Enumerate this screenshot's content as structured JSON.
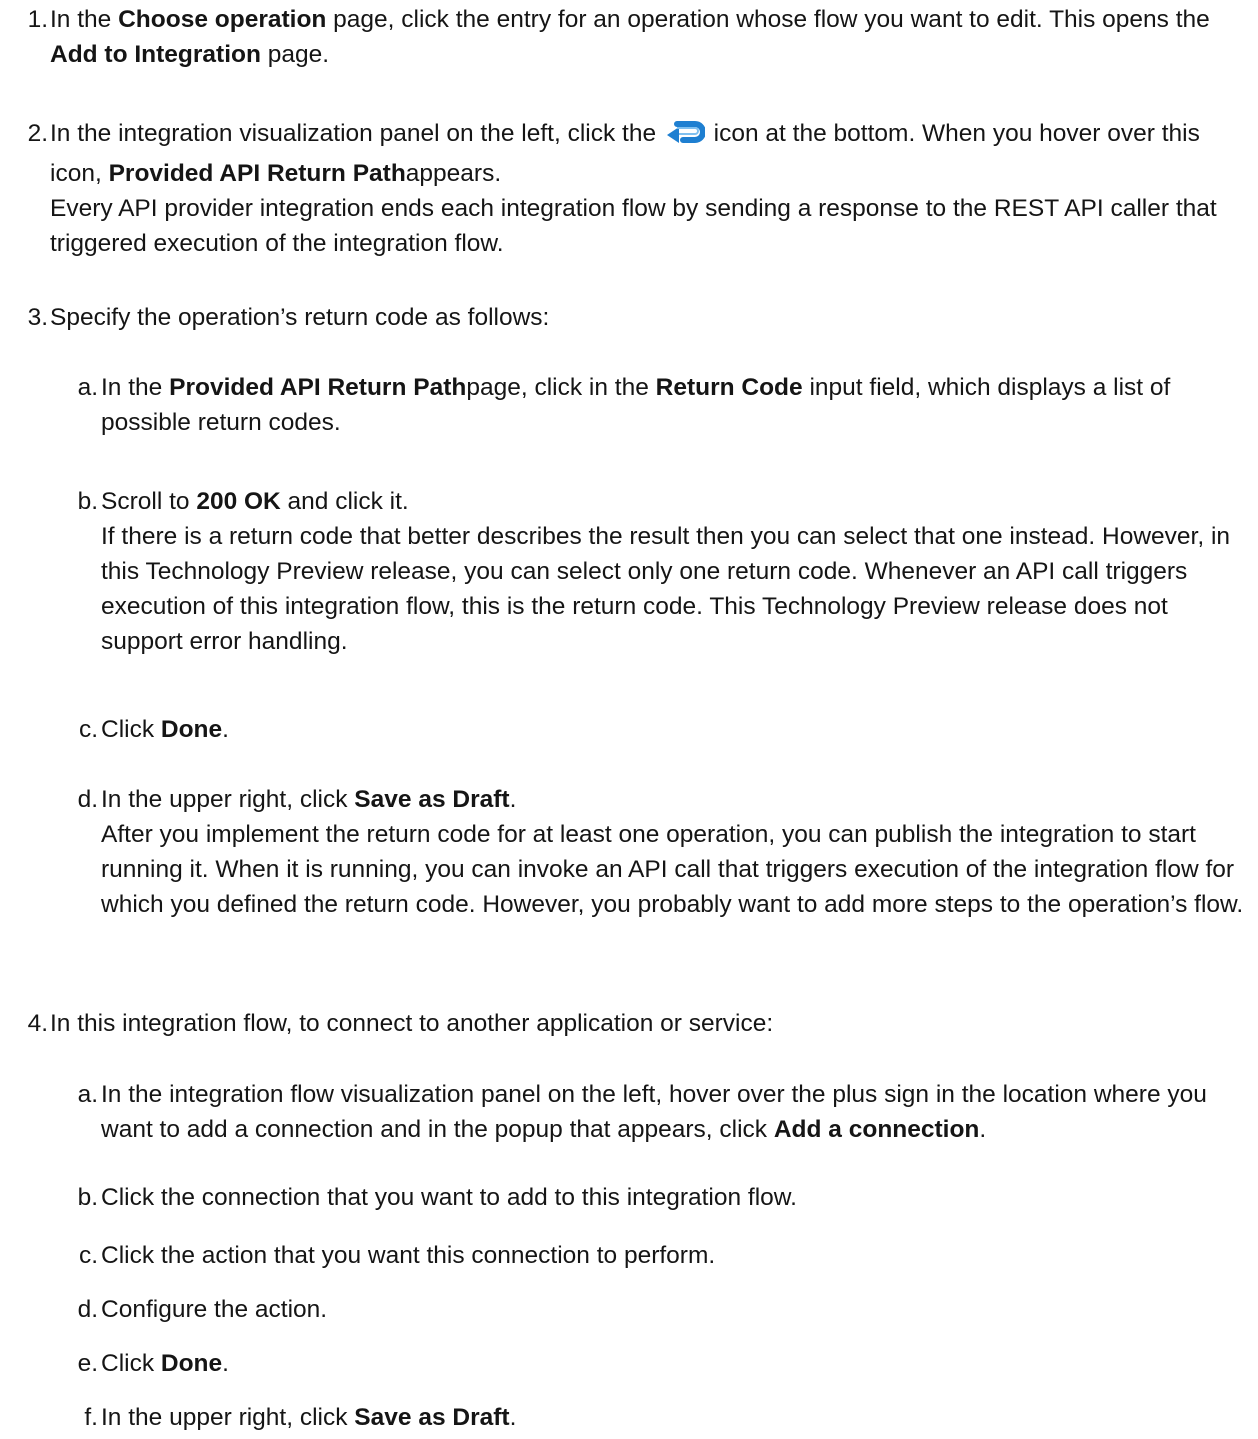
{
  "steps": [
    {
      "num": "1.",
      "parts": [
        "In the ",
        "Choose operation",
        " page, click the entry for an operation whose flow you want to edit. This opens the ",
        "Add to Integration",
        " page."
      ]
    },
    {
      "num": "2.",
      "parts": [
        "In the integration visualization panel on the left, click the ",
        " icon at the bottom. When you hover over this icon, ",
        "Provided API Return Path",
        "appears."
      ],
      "note": "Every API provider integration ends each integration flow by sending a response to the REST API caller that triggered execution of the integration flow.",
      "icon": "return-arrow-icon",
      "icon_color": "#1e7fd1"
    },
    {
      "num": "3.",
      "text": "Specify the operation’s return code as follows:",
      "substeps": [
        {
          "num": "a.",
          "parts": [
            "In the ",
            "Provided API Return Path",
            "page, click in the ",
            "Return Code",
            " input field, which displays a list of possible return codes."
          ]
        },
        {
          "num": "b.",
          "parts": [
            "Scroll to ",
            "200 OK",
            " and click it."
          ],
          "note": "If there is a return code that better describes the result then you can select that one instead. However, in this Technology Preview release, you can select only one return code. Whenever an API call triggers execution of this integration flow, this is the return code. This Technology Preview release does not support error handling."
        },
        {
          "num": "c.",
          "parts": [
            "Click ",
            "Done",
            "."
          ]
        },
        {
          "num": "d.",
          "parts": [
            "In the upper right, click ",
            "Save as Draft",
            "."
          ],
          "note": "After you implement the return code for at least one operation, you can publish the integration to start running it. When it is running, you can invoke an API call that triggers execution of the integration flow for which you defined the return code. However, you probably want to add more steps to the operation’s flow."
        }
      ]
    },
    {
      "num": "4.",
      "text": "In this integration flow, to connect to another application or service:",
      "substeps": [
        {
          "num": "a.",
          "parts": [
            "In the integration flow visualization panel on the left, hover over the plus sign in the location where you want to add a connection and in the popup that appears, click ",
            "Add a connection",
            "."
          ]
        },
        {
          "num": "b.",
          "text": "Click the connection that you want to add to this integration flow."
        },
        {
          "num": "c.",
          "text": "Click the action that you want this connection to perform."
        },
        {
          "num": "d.",
          "text": "Configure the action."
        },
        {
          "num": "e.",
          "parts": [
            "Click ",
            "Done",
            "."
          ]
        },
        {
          "num": "f.",
          "parts": [
            "In the upper right, click ",
            "Save as Draft",
            "."
          ]
        }
      ]
    }
  ]
}
